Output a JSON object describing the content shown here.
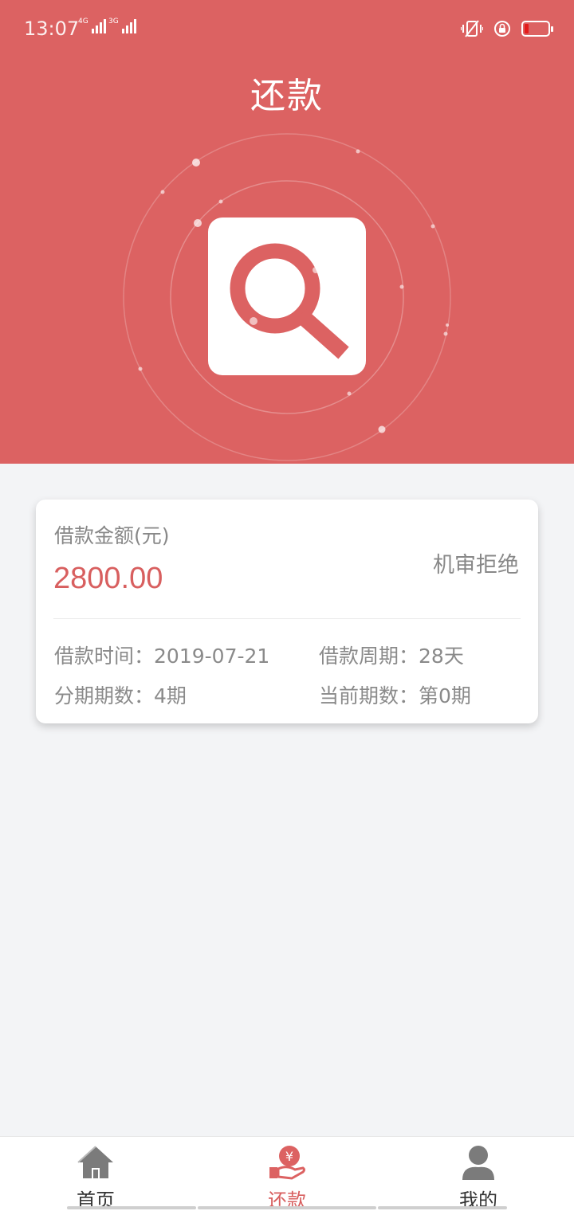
{
  "status_bar": {
    "time": "13:07",
    "network_labels": [
      "4G",
      "3G"
    ]
  },
  "header": {
    "title": "还款",
    "illustration": "magnifier-icon"
  },
  "loan": {
    "amount_label": "借款金额(元)",
    "amount_value": "2800.00",
    "status": "机审拒绝",
    "details": [
      {
        "label": "借款时间：",
        "value": "2019-07-21"
      },
      {
        "label": "借款周期：",
        "value": "28天"
      },
      {
        "label": "分期期数：",
        "value": "4期"
      },
      {
        "label": "当前期数：",
        "value": "第0期"
      }
    ]
  },
  "tab_bar": {
    "tabs": [
      {
        "label": "首页",
        "icon": "home-icon",
        "active": false
      },
      {
        "label": "还款",
        "icon": "repay-yuan-icon",
        "active": true
      },
      {
        "label": "我的",
        "icon": "user-icon",
        "active": false
      }
    ]
  },
  "colors": {
    "brand": "#dc6262",
    "accent_text": "#d85f5f",
    "background": "#f3f4f6"
  }
}
